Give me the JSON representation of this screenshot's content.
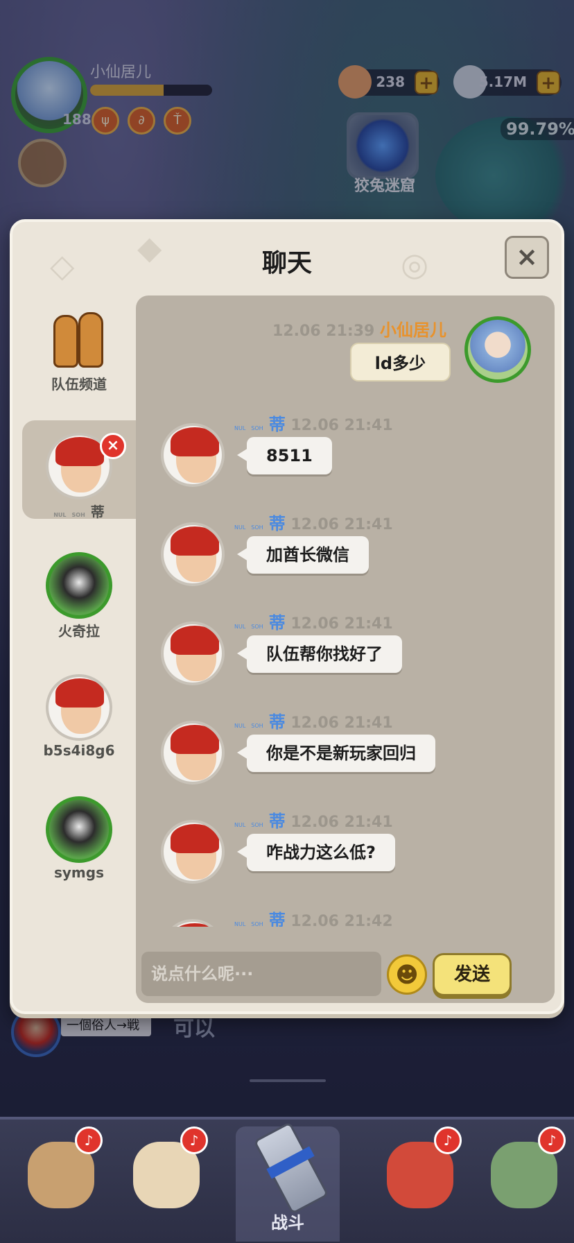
{
  "player": {
    "name": "小仙居儿",
    "level": "188",
    "xp_fraction": 0.6,
    "buffs": [
      "ψ",
      "∂",
      "Ť"
    ]
  },
  "currencies": [
    {
      "name": "shell-currency",
      "value": "238",
      "plus": "+"
    },
    {
      "name": "stone-currency",
      "value": "5.17M",
      "plus": "+"
    }
  ],
  "dungeon": {
    "label": "狡兔迷窟"
  },
  "map": {
    "progress": "99.79%"
  },
  "dialog": {
    "title": "聊天",
    "close_label": "×"
  },
  "sidebar": {
    "team_channel": "队伍频道",
    "contacts": [
      {
        "name": "蒂",
        "tags": [
          "NUL",
          "SOH"
        ],
        "remove_label": "×",
        "selected": true
      },
      {
        "name": "火奇拉",
        "selected": false
      },
      {
        "name": "b5s4i8g6",
        "selected": false
      },
      {
        "name": "symgs",
        "selected": false
      }
    ]
  },
  "chat": {
    "own_message": {
      "time": "12.06 21:39",
      "sender": "小仙居儿",
      "text": "ld多少"
    },
    "messages": [
      {
        "tags": [
          "NUL",
          "SOH"
        ],
        "sender": "蒂",
        "time": "12.06 21:41",
        "text": "8511"
      },
      {
        "tags": [
          "NUL",
          "SOH"
        ],
        "sender": "蒂",
        "time": "12.06 21:41",
        "text": "加酋长微信"
      },
      {
        "tags": [
          "NUL",
          "SOH"
        ],
        "sender": "蒂",
        "time": "12.06 21:41",
        "text": "队伍帮你找好了"
      },
      {
        "tags": [
          "NUL",
          "SOH"
        ],
        "sender": "蒂",
        "time": "12.06 21:41",
        "text": "你是不是新玩家回归"
      },
      {
        "tags": [
          "NUL",
          "SOH"
        ],
        "sender": "蒂",
        "time": "12.06 21:41",
        "text": "咋战力这么低?"
      },
      {
        "tags": [
          "NUL",
          "SOH"
        ],
        "sender": "蒂",
        "time": "12.06 21:42",
        "text": ""
      }
    ],
    "input_placeholder": "说点什么呢···",
    "emoji_icon": "☻",
    "send_label": "发送"
  },
  "background_chat": {
    "name": "一個俗人→戦",
    "text": "可以"
  },
  "bottom_nav": {
    "battle_label": "战斗",
    "bell_icon": "♪"
  },
  "colors": {
    "accent_blue": "#4b8ae0",
    "own_name_orange": "#e8922c",
    "send_yellow": "#f4e27a",
    "notify_red": "#e0342c"
  }
}
